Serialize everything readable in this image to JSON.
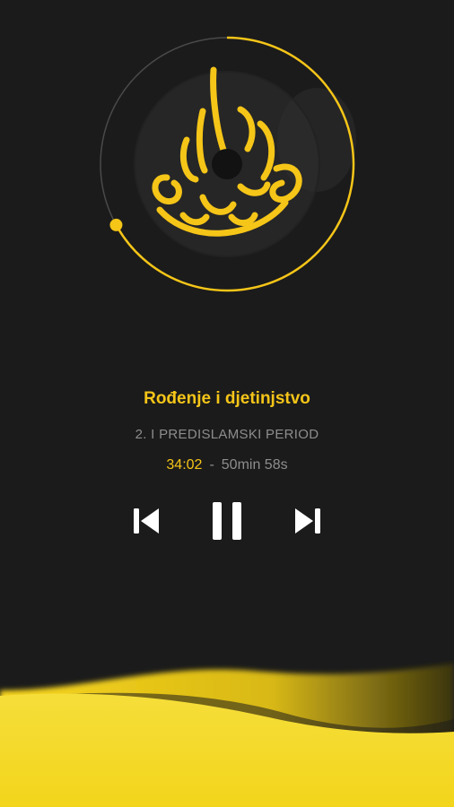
{
  "player": {
    "artwork": {
      "icon": "calligraphy-muhammad-rasul",
      "accent_color": "#f5c518",
      "disc_color": "#262626",
      "seek_progress": 0.67
    },
    "track_title": "Rođenje i djetinjstvo",
    "track_subtitle": "2. I PREDISLAMSKI PERIOD",
    "current_time": "34:02",
    "separator": "-",
    "total_time": "50min 58s",
    "controls": {
      "previous_icon": "skip-previous-icon",
      "pause_icon": "pause-icon",
      "next_icon": "skip-next-icon"
    }
  }
}
